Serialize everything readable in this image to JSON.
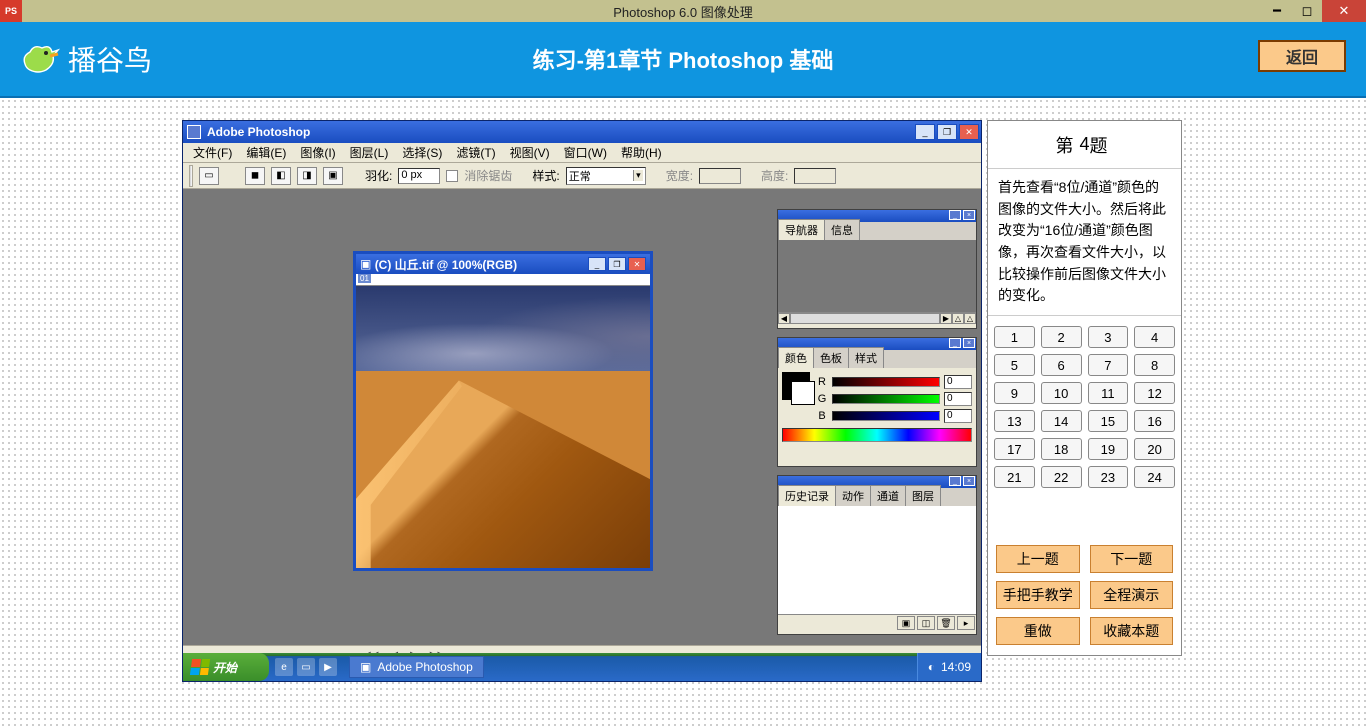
{
  "outer": {
    "title": "Photoshop 6.0 图像处理"
  },
  "header": {
    "brand": "播谷鸟",
    "title": "练习-第1章节 Photoshop 基础",
    "return": "返回"
  },
  "ps": {
    "title": "Adobe Photoshop",
    "menus": [
      "文件(F)",
      "编辑(E)",
      "图像(I)",
      "图层(L)",
      "选择(S)",
      "滤镜(T)",
      "视图(V)",
      "窗口(W)",
      "帮助(H)"
    ],
    "opts": {
      "feather_label": "羽化:",
      "feather_value": "0 px",
      "antialias": "消除锯齿",
      "style_label": "样式:",
      "style_value": "正常",
      "width_label": "宽度:",
      "height_label": "高度:"
    },
    "doc": {
      "title": "(C) 山丘.tif @ 100%(RGB)",
      "slice": "01"
    },
    "nav_tabs": [
      "导航器",
      "信息"
    ],
    "color_tabs": [
      "颜色",
      "色板",
      "样式"
    ],
    "color_labels": {
      "r": "R",
      "g": "G",
      "b": "B"
    },
    "color_values": {
      "r": "0",
      "g": "0",
      "b": "0"
    },
    "history_tabs": [
      "历史记录",
      "动作",
      "通道",
      "图层"
    ],
    "taskbar": {
      "start": "开始",
      "app": "Adobe Photoshop",
      "time": "14:09"
    }
  },
  "exercise": {
    "title_prefix": "第",
    "title_num": "4",
    "title_suffix": "题",
    "desc": "首先查看“8位/通道”颜色的图像的文件大小。然后将此改变为“16位/通道”颜色图像，再次查看文件大小，以比较操作前后图像文件大小的变化。",
    "numbers": [
      "1",
      "2",
      "3",
      "4",
      "5",
      "6",
      "7",
      "8",
      "9",
      "10",
      "11",
      "12",
      "13",
      "14",
      "15",
      "16",
      "17",
      "18",
      "19",
      "20",
      "21",
      "22",
      "23",
      "24"
    ],
    "prev": "上一题",
    "next": "下一题",
    "stepbystep": "手把手教学",
    "fulldemo": "全程演示",
    "redo": "重做",
    "favorite": "收藏本题"
  }
}
